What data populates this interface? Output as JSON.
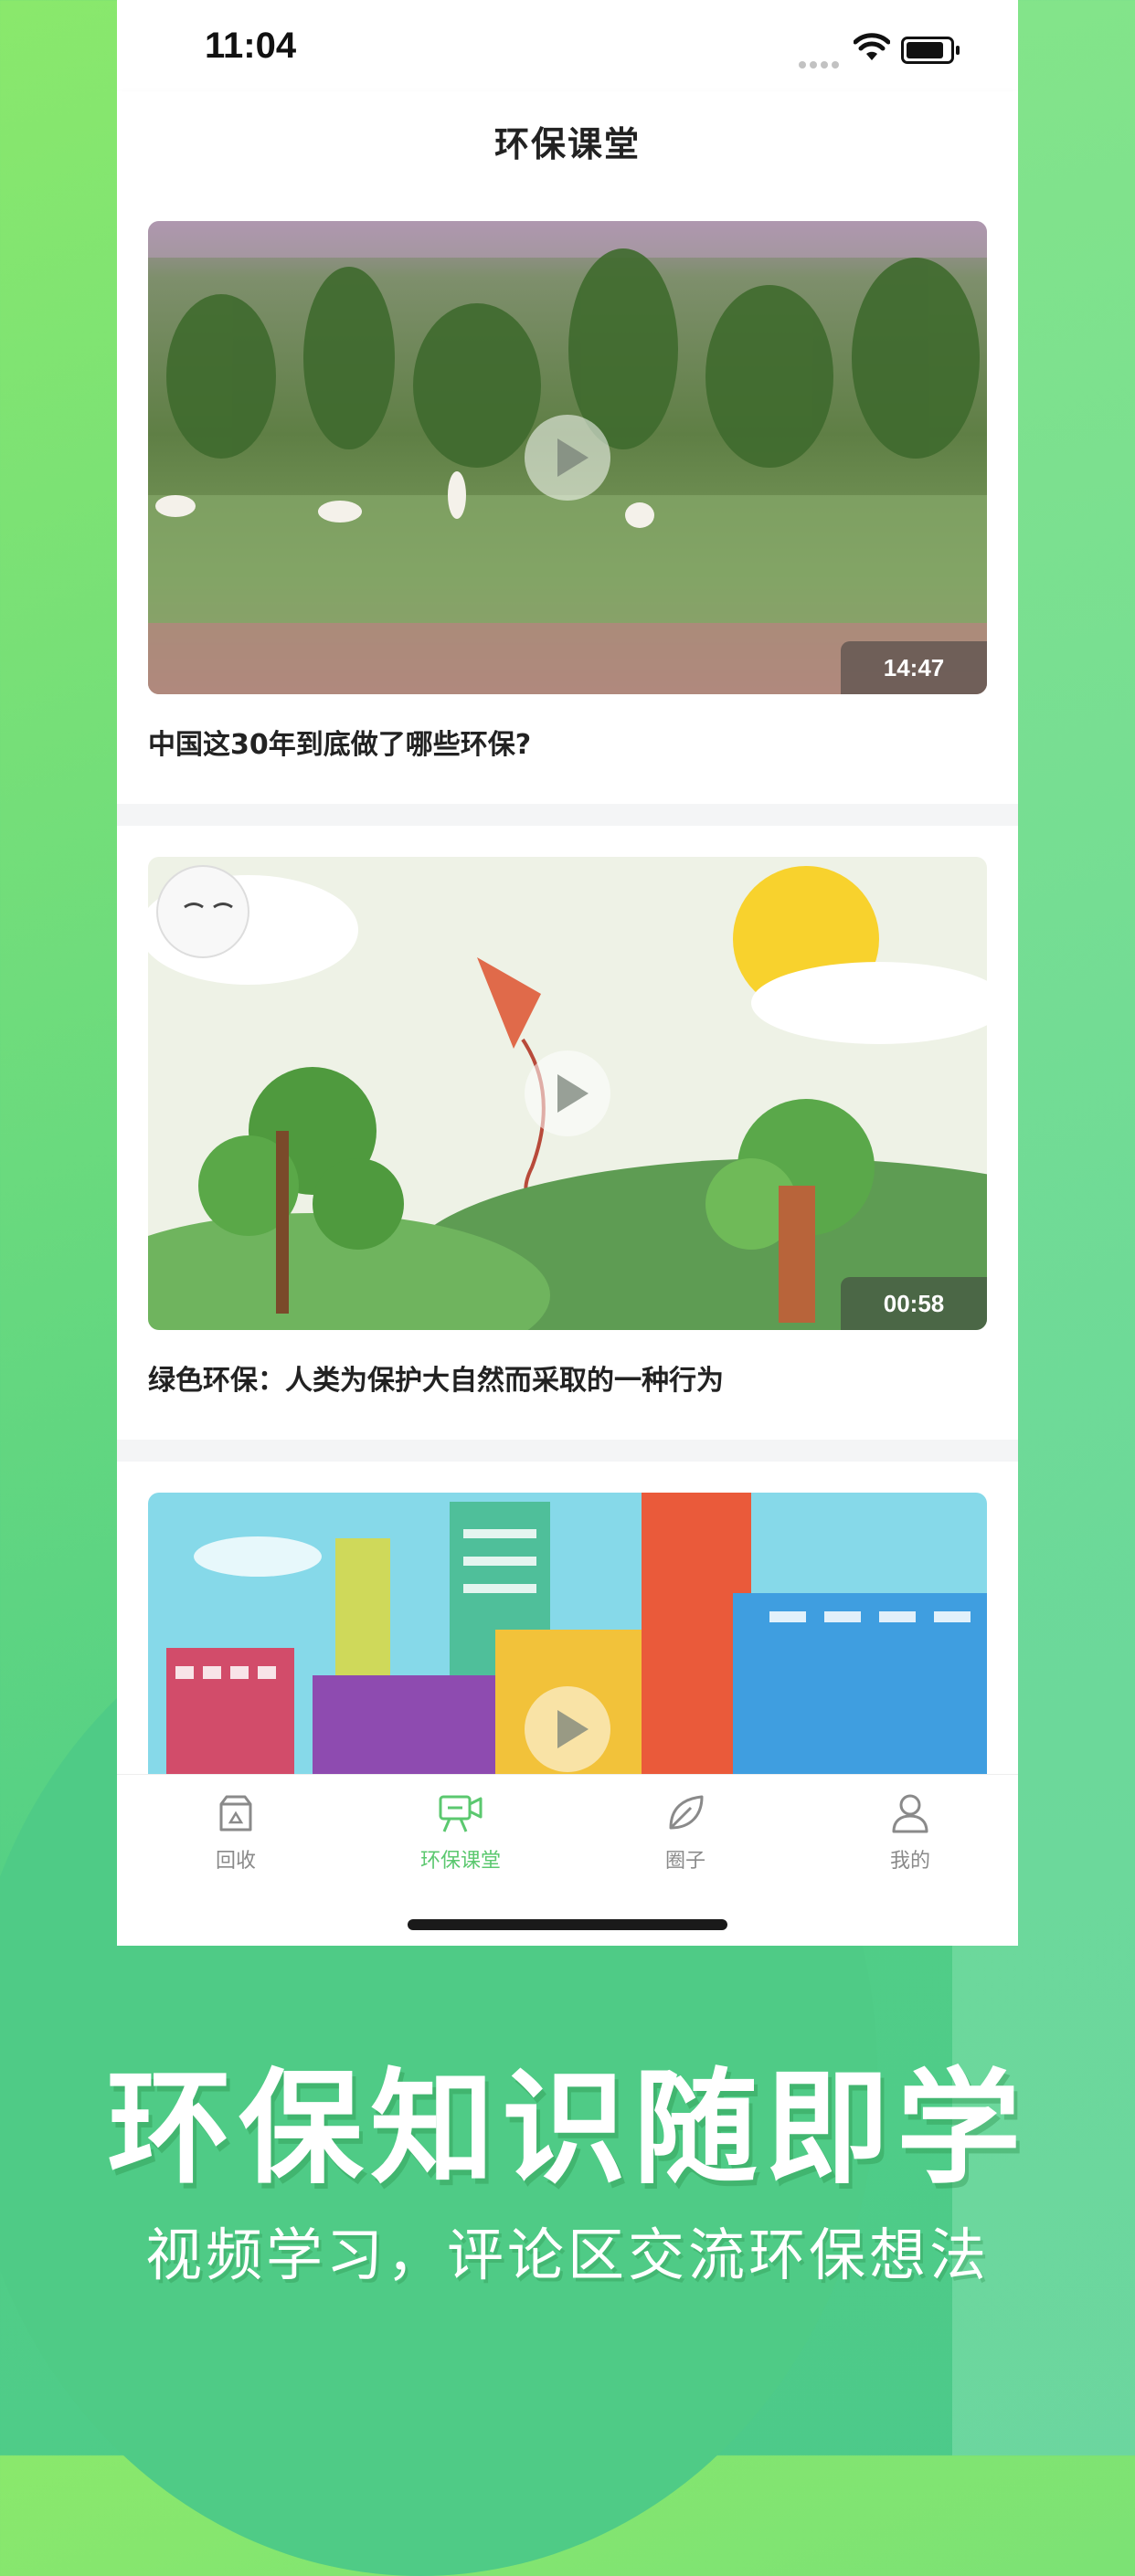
{
  "status_bar": {
    "time": "11:04"
  },
  "nav": {
    "title": "环保课堂"
  },
  "videos": [
    {
      "title": "中国这30年到底做了哪些环保?",
      "duration": "14:47"
    },
    {
      "title": "绿色环保：人类为保护大自然而采取的一种行为",
      "duration": "00:58"
    },
    {
      "title": "",
      "duration": ""
    }
  ],
  "tabs": [
    {
      "label": "回收",
      "icon": "recycle-bin-icon",
      "active": false
    },
    {
      "label": "环保课堂",
      "icon": "video-class-icon",
      "active": true
    },
    {
      "label": "圈子",
      "icon": "leaf-icon",
      "active": false
    },
    {
      "label": "我的",
      "icon": "profile-icon",
      "active": false
    }
  ],
  "promo": {
    "headline": "环保知识随即学",
    "subline": "视频学习，评论区交流环保想法"
  },
  "colors": {
    "accent": "#5bc86f",
    "inactive": "#8a8a8a"
  }
}
